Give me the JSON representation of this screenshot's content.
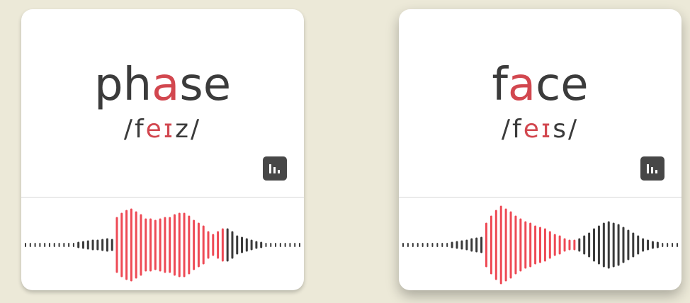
{
  "cards": [
    {
      "word": {
        "before": "ph",
        "highlight": "a",
        "after": "se"
      },
      "ipa": {
        "before": "/f",
        "highlight": "eɪ",
        "after": "z/"
      },
      "stats_icon": "bar-chart-icon",
      "wave": {
        "accent_color": "#ee4a55",
        "base_color": "#3a3a3a",
        "amplitudes": [
          2,
          2,
          2,
          2,
          2,
          2,
          2,
          2,
          2,
          2,
          2,
          3,
          4,
          5,
          6,
          6,
          7,
          8,
          7,
          38,
          44,
          48,
          50,
          46,
          42,
          36,
          36,
          34,
          36,
          38,
          38,
          42,
          44,
          44,
          40,
          34,
          30,
          26,
          18,
          14,
          18,
          22,
          22,
          18,
          12,
          10,
          8,
          6,
          4,
          3,
          2,
          2,
          2,
          2,
          2,
          2,
          2,
          2
        ],
        "accent_start": 19,
        "accent_end": 41
      }
    },
    {
      "word": {
        "before": "f",
        "highlight": "a",
        "after": "ce"
      },
      "ipa": {
        "before": "/f",
        "highlight": "eɪ",
        "after": "s/"
      },
      "stats_icon": "bar-chart-icon",
      "wave": {
        "accent_color": "#ee4a55",
        "base_color": "#3a3a3a",
        "amplitudes": [
          2,
          2,
          2,
          2,
          2,
          2,
          2,
          2,
          2,
          2,
          3,
          4,
          5,
          6,
          8,
          9,
          10,
          30,
          40,
          48,
          54,
          50,
          46,
          40,
          36,
          32,
          30,
          26,
          24,
          22,
          18,
          14,
          12,
          8,
          6,
          6,
          8,
          12,
          16,
          22,
          26,
          30,
          32,
          30,
          28,
          24,
          20,
          16,
          12,
          8,
          6,
          4,
          3,
          2,
          2,
          2,
          2
        ],
        "accent_start": 17,
        "accent_end": 35
      }
    }
  ]
}
